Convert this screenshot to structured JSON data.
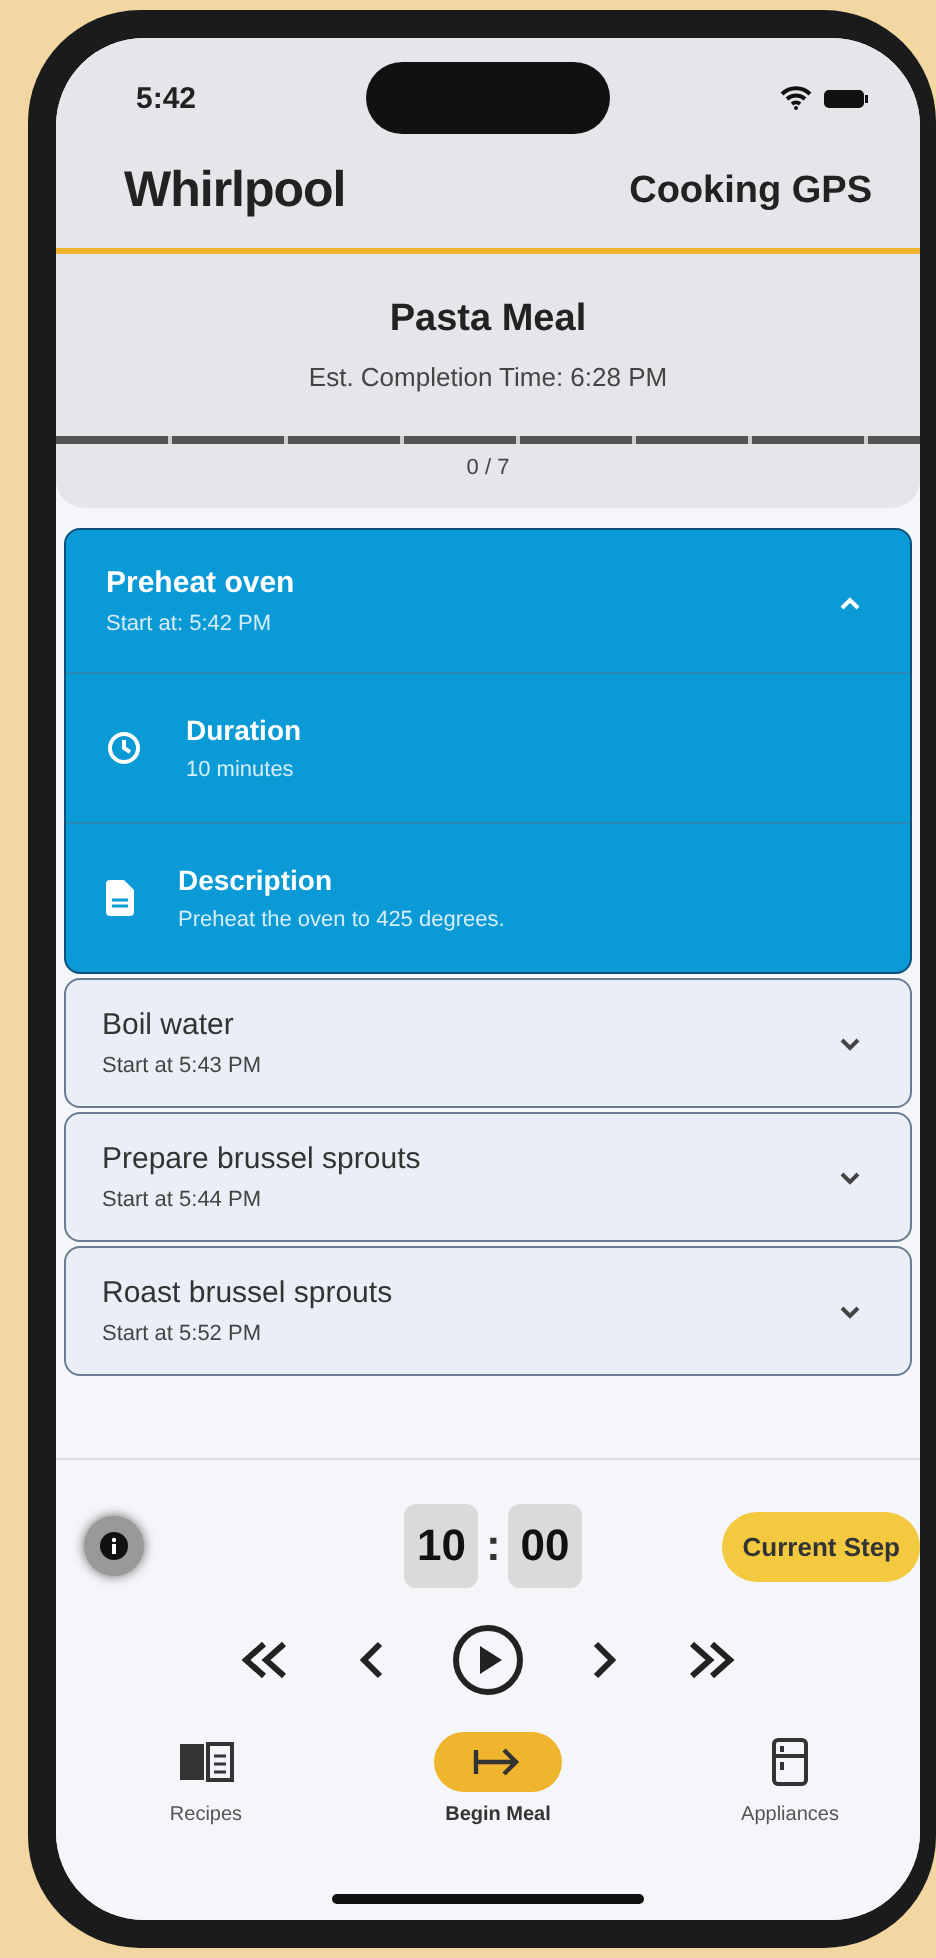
{
  "status_bar": {
    "time": "5:42"
  },
  "header": {
    "logo": "Whirlpool",
    "title": "Cooking GPS"
  },
  "meal": {
    "name": "Pasta Meal",
    "estimate": "Est. Completion Time: 6:28 PM",
    "progress": {
      "level": 0
    },
    "progress_text": "0 / 7"
  },
  "steps": [
    {
      "title": "Preheat oven",
      "start": "Start at: 5:42 PM",
      "expanded": true,
      "details": [
        {
          "kind": "duration",
          "label": "Duration",
          "value": "10 minutes"
        },
        {
          "kind": "description",
          "label": "Description",
          "value": "Preheat the oven to 425 degrees."
        }
      ]
    },
    {
      "title": "Boil water",
      "start": "Start at 5:43 PM",
      "expanded": false
    },
    {
      "title": "Prepare brussel sprouts",
      "start": "Start at 5:44 PM",
      "expanded": false
    },
    {
      "title": "Roast brussel sprouts",
      "start": "Start at 5:52 PM",
      "expanded": false
    }
  ],
  "timer": {
    "minutes": "10",
    "separator": ":",
    "seconds": "00"
  },
  "current_step_button": "Current Step",
  "nav": [
    {
      "label": "Recipes",
      "kind": "book",
      "selected": false
    },
    {
      "label": "Begin Meal",
      "kind": "begin",
      "selected": true
    },
    {
      "label": "Appliances",
      "kind": "fridge",
      "selected": false
    }
  ]
}
